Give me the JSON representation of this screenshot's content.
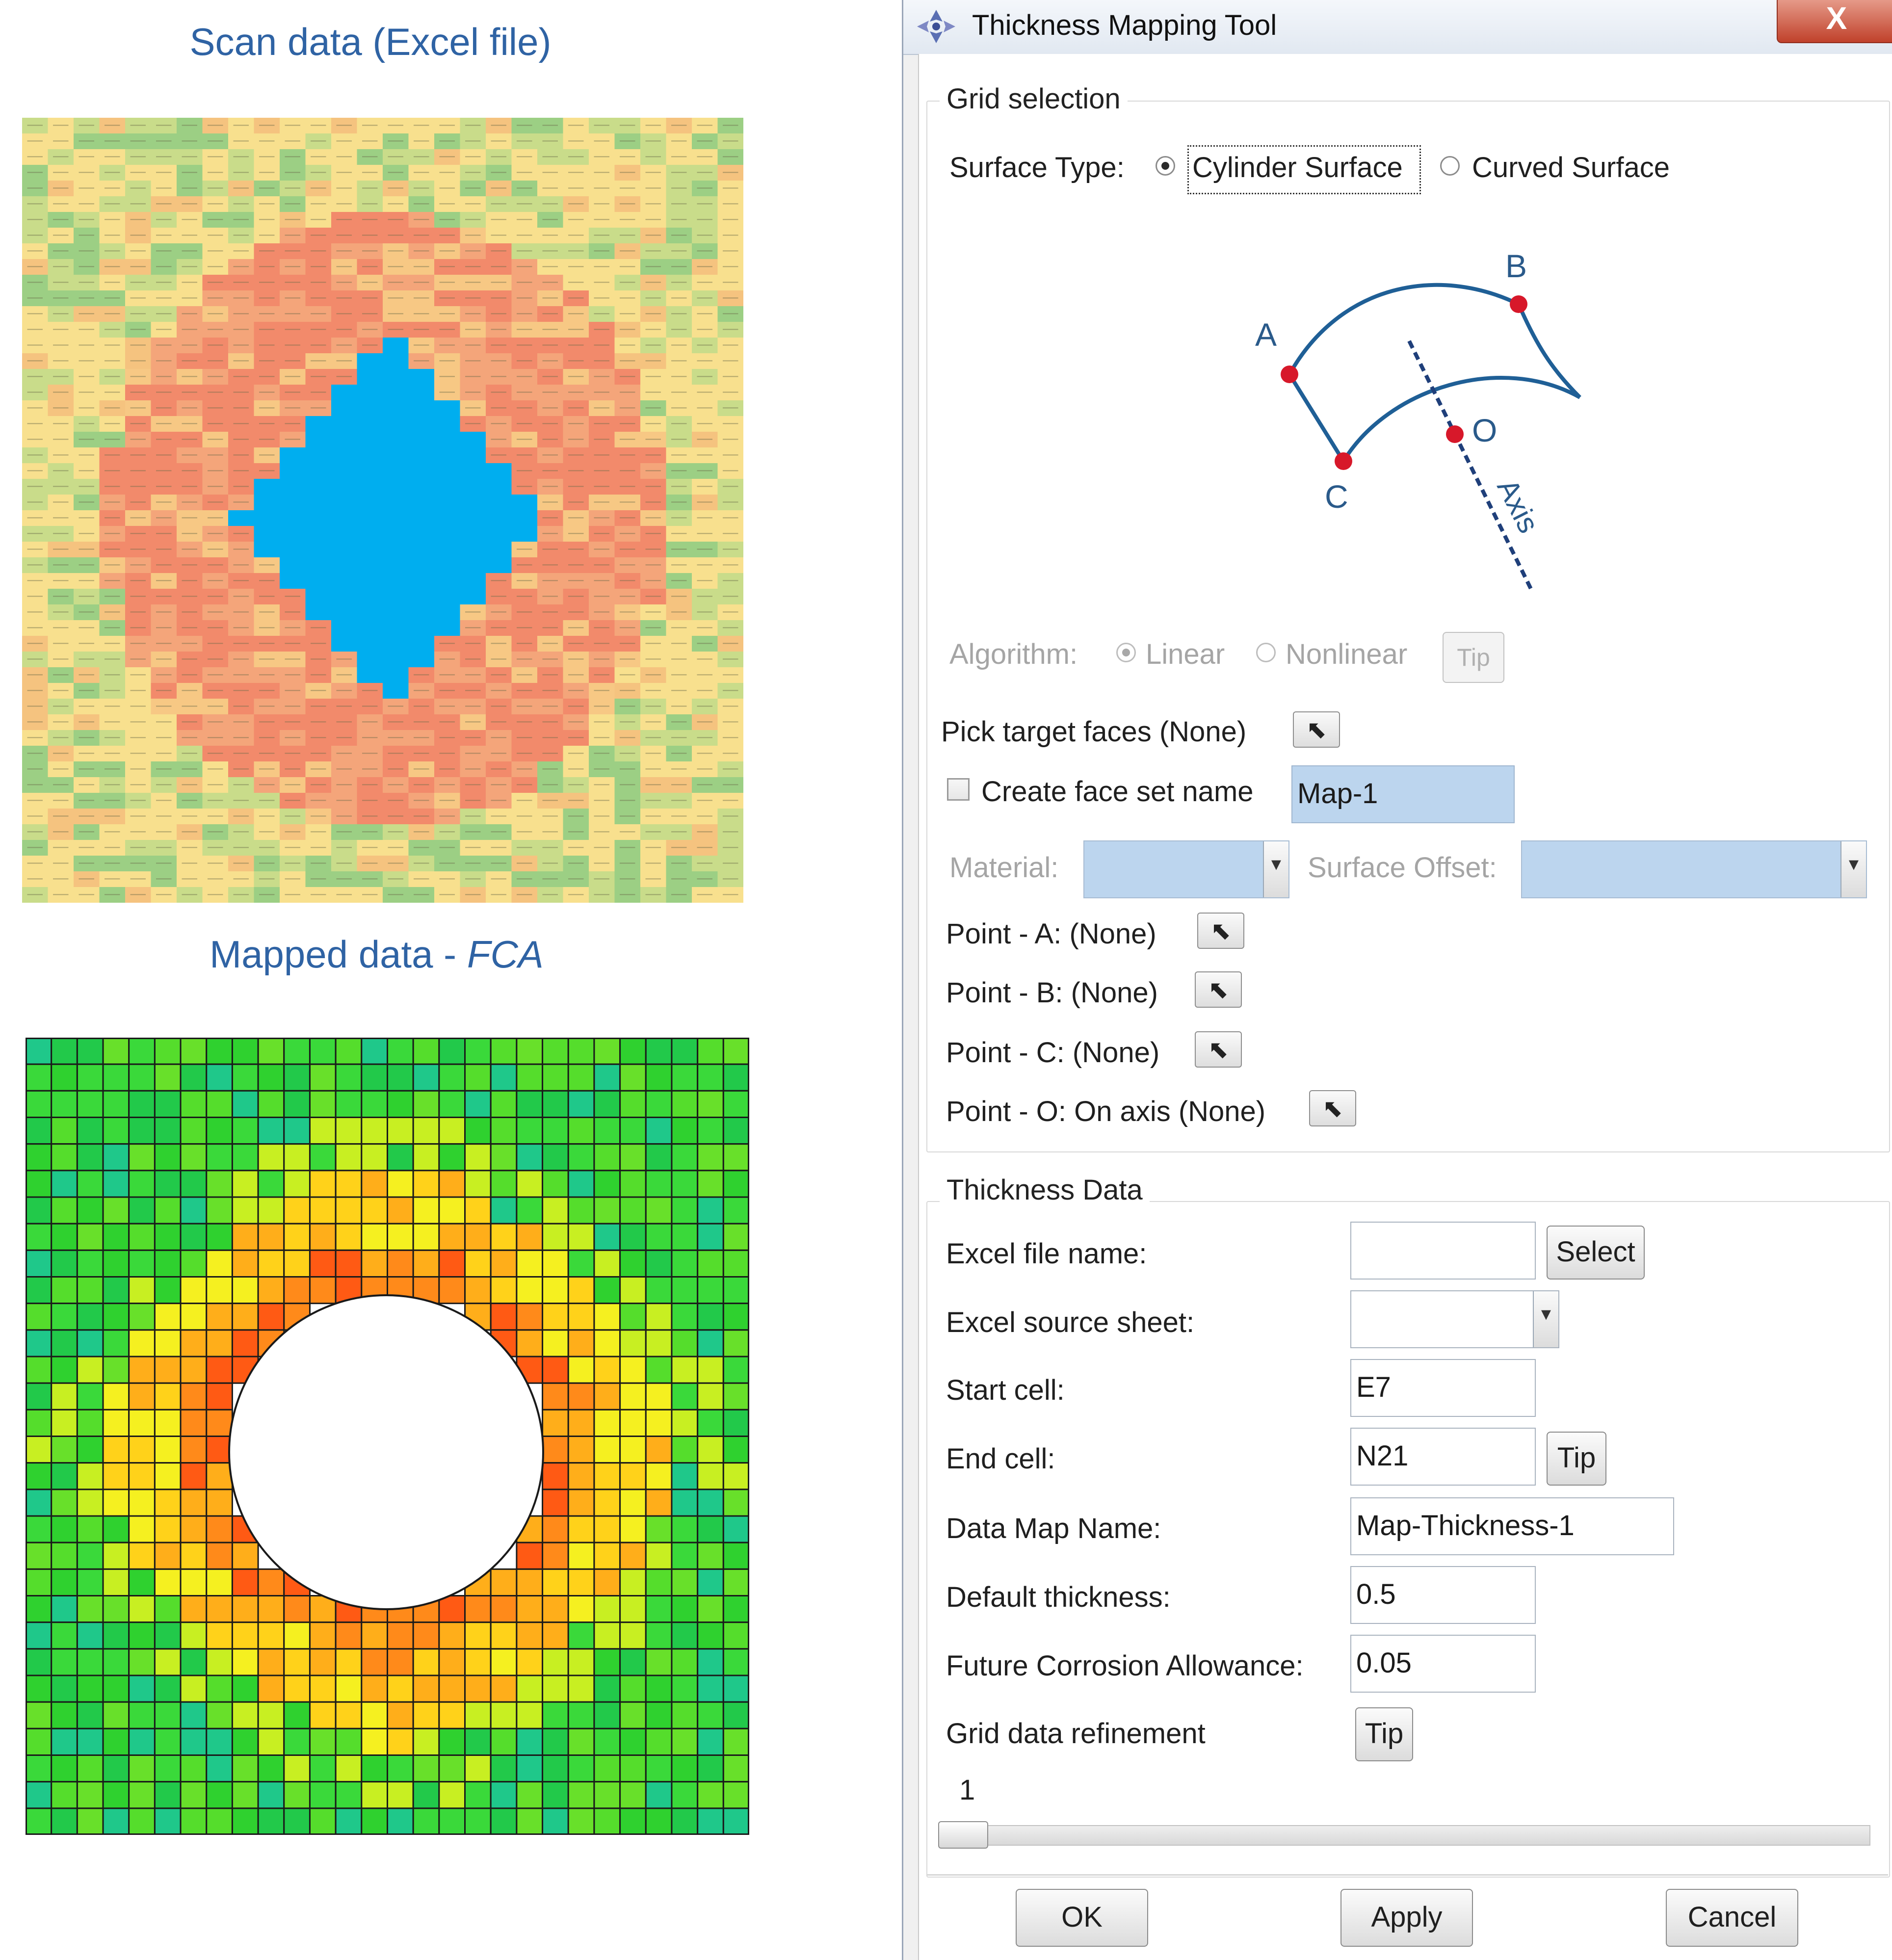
{
  "left_panel": {
    "scan_caption": "Scan data (Excel file)",
    "mapped_caption_prefix": "Mapped data - ",
    "mapped_caption_italic": "FCA"
  },
  "dialog": {
    "title": "Thickness Mapping Tool",
    "close_label": "X",
    "grid_selection": {
      "title": "Grid selection",
      "surface_type_label": "Surface Type:",
      "options": [
        "Cylinder Surface",
        "Curved Surface"
      ],
      "selected": "Cylinder Surface",
      "diagram_labels": {
        "a": "A",
        "b": "B",
        "c": "C",
        "o": "O",
        "axis": "Axis"
      },
      "algorithm_label": "Algorithm:",
      "algorithm_options": [
        "Linear",
        "Nonlinear"
      ],
      "algorithm_selected": "Linear",
      "algorithm_tip": "Tip",
      "pick_target_faces": "Pick target faces (None)",
      "create_face_set_label": "Create face set name",
      "face_set_name": "Map-1",
      "material_label": "Material:",
      "surface_offset_label": "Surface Offset:",
      "point_a": "Point - A: (None)",
      "point_b": "Point - B: (None)",
      "point_c": "Point - C: (None)",
      "point_o": "Point - O: On axis (None)"
    },
    "thickness_data": {
      "title": "Thickness Data",
      "excel_file_label": "Excel file name:",
      "excel_file_value": "",
      "select_button": "Select",
      "source_sheet_label": "Excel source sheet:",
      "source_sheet_value": "",
      "start_cell_label": "Start cell:",
      "start_cell_value": "E7",
      "end_cell_label": "End cell:",
      "end_cell_value": "N21",
      "end_cell_tip": "Tip",
      "data_map_label": "Data Map Name:",
      "data_map_value": "Map-Thickness-1",
      "default_thickness_label": "Default thickness:",
      "default_thickness_value": "0.5",
      "fca_label": "Future Corrosion Allowance:",
      "fca_value": "0.05",
      "refinement_label": "Grid data refinement",
      "refinement_tip": "Tip",
      "refinement_value": "1"
    },
    "buttons": {
      "ok": "OK",
      "apply": "Apply",
      "cancel": "Cancel"
    }
  }
}
